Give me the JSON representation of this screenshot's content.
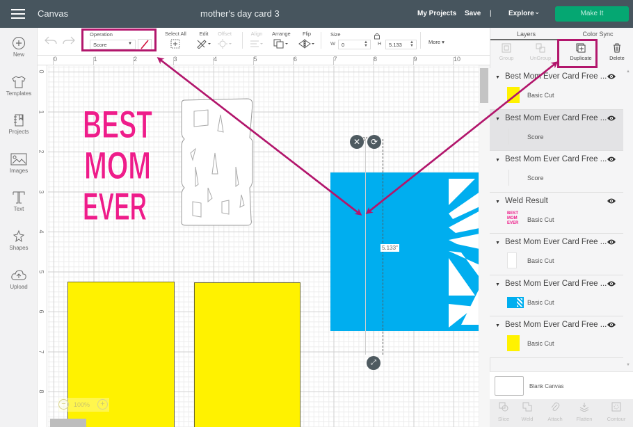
{
  "topbar": {
    "app_title": "Canvas",
    "doc_title": "mother's day card 3",
    "my_projects": "My Projects",
    "save": "Save",
    "separator": "|",
    "explore": "Explore",
    "make_it": "Make It"
  },
  "sidebar": {
    "items": [
      {
        "label": "New",
        "icon": "plus-circle-icon"
      },
      {
        "label": "Templates",
        "icon": "tshirt-icon"
      },
      {
        "label": "Projects",
        "icon": "notebook-icon"
      },
      {
        "label": "Images",
        "icon": "image-icon"
      },
      {
        "label": "Text",
        "icon": "text-t-icon"
      },
      {
        "label": "Shapes",
        "icon": "shapes-icon"
      },
      {
        "label": "Upload",
        "icon": "cloud-upload-icon"
      }
    ]
  },
  "toolbar": {
    "operation_label": "Operation",
    "operation_value": "Score",
    "operation_color": "#d0103a",
    "select_all": "Select All",
    "edit": "Edit",
    "offset": "Offset",
    "align": "Align",
    "arrange": "Arrange",
    "flip": "Flip",
    "size_label": "Size",
    "w_label": "W",
    "w_value": "0",
    "h_label": "H",
    "h_value": "5.133",
    "more": "More"
  },
  "canvas": {
    "ruler_h": [
      "0",
      "1",
      "2",
      "3",
      "4",
      "5",
      "6",
      "7",
      "8",
      "9",
      "10"
    ],
    "ruler_v": [
      "0",
      "1",
      "2",
      "3",
      "4",
      "5",
      "6",
      "7",
      "8"
    ],
    "rotation_label": "0°",
    "dimension_label": "5.133\"",
    "zoom_level": "100%",
    "zoom_out": "−",
    "zoom_in": "+",
    "pink_text": [
      "BEST",
      "MOM",
      "EVER"
    ],
    "colors": {
      "pink": "#ee1c8a",
      "yellow": "#fff200",
      "blue": "#00aeef",
      "annotation": "#b2166c"
    }
  },
  "panel": {
    "tabs": [
      "Layers",
      "Color Sync"
    ],
    "actions": [
      {
        "label": "Group",
        "enabled": false
      },
      {
        "label": "UnGroup",
        "enabled": false
      },
      {
        "label": "Duplicate",
        "enabled": true
      },
      {
        "label": "Delete",
        "enabled": true
      }
    ],
    "layers": [
      {
        "name": "Best Mom Ever Card Free ...",
        "operation": "Basic Cut",
        "thumb": "yellow"
      },
      {
        "name": "Best Mom Ever Card Free ...",
        "operation": "Score",
        "thumb": "none"
      },
      {
        "name": "Best Mom Ever Card Free ...",
        "operation": "Score",
        "thumb": "none"
      },
      {
        "name": "Weld Result",
        "operation": "Basic Cut",
        "thumb": "pink-text"
      },
      {
        "name": "Best Mom Ever Card Free ...",
        "operation": "Basic Cut",
        "thumb": "white-text"
      },
      {
        "name": "Best Mom Ever Card Free ...",
        "operation": "Basic Cut",
        "thumb": "blue"
      },
      {
        "name": "Best Mom Ever Card Free ...",
        "operation": "Basic Cut",
        "thumb": "yellow"
      }
    ],
    "blank_canvas": "Blank Canvas",
    "bottom_actions": [
      "Slice",
      "Weld",
      "Attach",
      "Flatten",
      "Contour"
    ]
  }
}
